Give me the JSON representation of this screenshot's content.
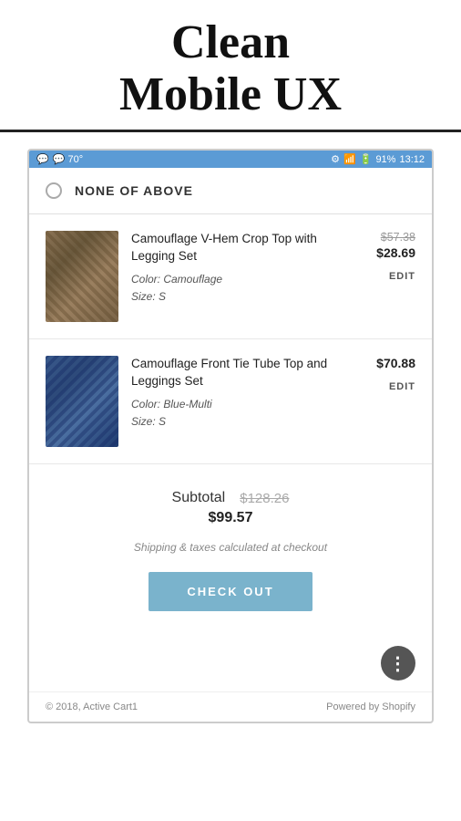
{
  "header": {
    "title": "Clean\nMobile UX"
  },
  "statusBar": {
    "left": "💬 70°",
    "icons": "🔵 📶 🔋",
    "right": "91%  13:12"
  },
  "noneOption": {
    "label": "NONE OF ABOVE"
  },
  "cartItems": [
    {
      "id": "item1",
      "name": "Camouflage V-Hem Crop Top with Legging Set",
      "color": "Camouflage",
      "size": "S",
      "priceOriginal": "$57.38",
      "priceSale": "$28.69",
      "editLabel": "EDIT",
      "colorLabel": "Color: Camouflage",
      "sizeLabel": "Size: S"
    },
    {
      "id": "item2",
      "name": "Camouflage Front Tie Tube Top and Leggings Set",
      "color": "Blue-Multi",
      "size": "S",
      "priceOriginal": "",
      "priceSale": "$70.88",
      "editLabel": "EDIT",
      "colorLabel": "Color: Blue-Multi",
      "sizeLabel": "Size: S"
    }
  ],
  "subtotal": {
    "label": "Subtotal",
    "originalPrice": "$128.26",
    "salePrice": "$99.57",
    "shippingNote": "Shipping & taxes calculated at checkout",
    "checkoutLabel": "CHECK OUT"
  },
  "footer": {
    "copyright": "© 2018, Active Cart1",
    "poweredBy": "Powered by Shopify"
  }
}
